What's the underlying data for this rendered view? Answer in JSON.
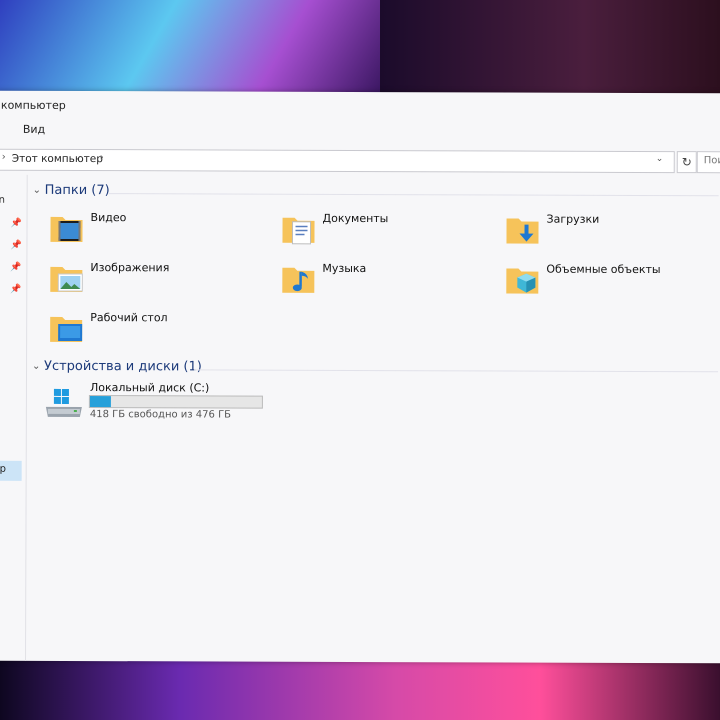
{
  "window": {
    "title": "компьютер",
    "ribbon_tab": "Вид"
  },
  "address": {
    "path": "Этот компьютер",
    "search_placeholder": "Пои"
  },
  "navpane": {
    "top_letter": "n",
    "selected_label": "р"
  },
  "sections": {
    "folders_header": "Папки (7)",
    "devices_header": "Устройства и диски (1)"
  },
  "folders": [
    {
      "label": "Видео",
      "icon": "video-folder-icon"
    },
    {
      "label": "Документы",
      "icon": "documents-folder-icon"
    },
    {
      "label": "Загрузки",
      "icon": "downloads-folder-icon"
    },
    {
      "label": "Изображения",
      "icon": "pictures-folder-icon"
    },
    {
      "label": "Музыка",
      "icon": "music-folder-icon"
    },
    {
      "label": "Объемные объекты",
      "icon": "3d-objects-folder-icon"
    },
    {
      "label": "Рабочий стол",
      "icon": "desktop-folder-icon"
    }
  ],
  "drive": {
    "name": "Локальный диск (C:)",
    "free_text": "418 ГБ свободно из 476 ГБ",
    "used_fraction": 0.12
  },
  "colors": {
    "accent": "#26a0da",
    "section_text": "#1c3a7a",
    "folder_yellow": "#f6c35a"
  }
}
